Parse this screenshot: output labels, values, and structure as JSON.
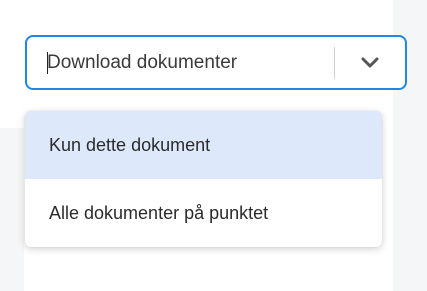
{
  "select": {
    "value": "Download dokumenter",
    "toggle_icon": "chevron-down-icon"
  },
  "menu": {
    "options": [
      {
        "label": "Kun dette dokument",
        "highlighted": true
      },
      {
        "label": "Alle dokumenter på punktet",
        "highlighted": false
      }
    ]
  },
  "colors": {
    "focus_border": "#1e88e5",
    "highlight": "#dde9fb",
    "text": "#2b2b2b",
    "divider": "#cfcfcf",
    "chevron": "#555555",
    "side_background": "#f5f6f7"
  }
}
